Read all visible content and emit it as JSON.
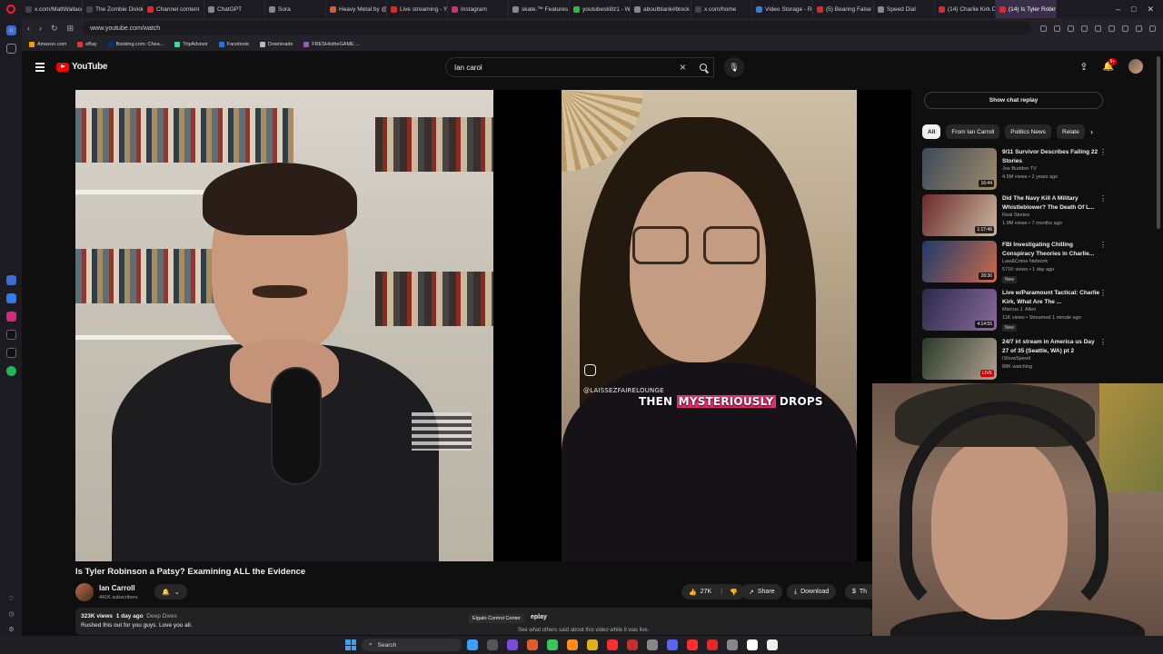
{
  "browser": {
    "tabs": [
      {
        "label": "x.com/MattWallace",
        "color": "#444444",
        "active": false
      },
      {
        "label": "The Zombie Divide",
        "color": "#444444",
        "active": false
      },
      {
        "label": "Channel content",
        "color": "#e02828",
        "active": false
      },
      {
        "label": "ChatGPT",
        "color": "#888888",
        "active": false
      },
      {
        "label": "Sora",
        "color": "#888888",
        "active": false
      },
      {
        "label": "Heavy Metal by @",
        "color": "#e05a2a",
        "active": false
      },
      {
        "label": "Live streaming - Yo",
        "color": "#e02828",
        "active": false
      },
      {
        "label": "Instagram",
        "color": "#d6297a",
        "active": false
      },
      {
        "label": "skate.™ Features",
        "color": "#888888",
        "active": false
      },
      {
        "label": "youtubeskillz1 - W",
        "color": "#2db84d",
        "active": false
      },
      {
        "label": "aboutblank#block",
        "color": "#888888",
        "active": false
      },
      {
        "label": "x.com/home",
        "color": "#444444",
        "active": false
      },
      {
        "label": "Video Storage - Re",
        "color": "#3a7bd5",
        "active": false
      },
      {
        "label": "(5) Bearing False W",
        "color": "#e02828",
        "active": false
      },
      {
        "label": "Speed Dial",
        "color": "#888888",
        "active": false
      },
      {
        "label": "(14) Charlie Kirk D",
        "color": "#e02828",
        "active": false
      },
      {
        "label": "(14) Is Tyler Robinson",
        "color": "#e02828",
        "active": true
      }
    ],
    "url": "www.youtube.com/watch",
    "bookmarks": [
      {
        "label": "Amazon.com",
        "color": "#ff9900"
      },
      {
        "label": "eBay",
        "color": "#e53238"
      },
      {
        "label": "Booking.com: Chea...",
        "color": "#003580"
      },
      {
        "label": "TripAdvisor",
        "color": "#34e0a1"
      },
      {
        "label": "Facebook",
        "color": "#1877f2"
      },
      {
        "label": "Downloads",
        "color": "#bbbbbb"
      },
      {
        "label": "FRESHistheGAME ...",
        "color": "#9b59b6"
      }
    ]
  },
  "youtube": {
    "logo_text": "YouTube",
    "search_value": "Ian carol",
    "notification_count": "9+"
  },
  "video": {
    "overlay_handle": "@LAISSEZFAIRELOUNGE",
    "caption_plain": "THEN",
    "caption_highlight": "MYSTERIOUSLY",
    "caption_end": "DROPS",
    "title": "Is Tyler Robinson a Patsy? Examining ALL the Evidence",
    "channel": "Ian Carroll",
    "subscribers": "441K subscribers",
    "likes": "27K",
    "share_label": "Share",
    "download_label": "Download",
    "thanks_label": "Th",
    "views": "323K views",
    "age": "1 day ago",
    "tag": "Deep Dives",
    "description": "Rushed this out for you guys. Love you all.",
    "tooltip": "Elgato Control Center",
    "replay_fragment": "eplay",
    "chat_hint": "See what others said about this video while it was live."
  },
  "sidebar_right": {
    "chat_replay_label": "Show chat replay",
    "chips": [
      {
        "label": "All",
        "selected": true
      },
      {
        "label": "From Ian Carroll",
        "selected": false
      },
      {
        "label": "Politics News",
        "selected": false
      },
      {
        "label": "Relate",
        "selected": false
      }
    ],
    "recommendations": [
      {
        "title": "9/11 Survivor Describes Falling 22 Stories",
        "channel": "Joe Budden TV",
        "meta": "4.5M views • 2 years ago",
        "duration": "16:44",
        "badge": "",
        "thumb_a": "#3b4a5a",
        "thumb_b": "#a08a6a"
      },
      {
        "title": "Did The Navy Kill A Military Whistleblower? The Death Of L...",
        "channel": "Real Stories",
        "meta": "1.9M views • 7 months ago",
        "duration": "1:17:46",
        "badge": "",
        "thumb_a": "#6b2a2a",
        "thumb_b": "#c9b8a0"
      },
      {
        "title": "FBI Investigating Chilling Conspiracy Theories in Charlie...",
        "channel": "Law&Crime Network",
        "meta": "571K views • 1 day ago",
        "duration": "28:36",
        "badge": "New",
        "thumb_a": "#1f3a6b",
        "thumb_b": "#c96a4a"
      },
      {
        "title": "Live w/Paramount Tactical: Charlie Kirk, What Are The ...",
        "channel": "Marcus J. Allen",
        "meta": "11K views • Streamed 1 minute ago",
        "duration": "4:14:55",
        "badge": "New",
        "thumb_a": "#2a2a4a",
        "thumb_b": "#8a6a9a"
      },
      {
        "title": "24/7 irl stream in America us Day 27 of 35 (Seattle, WA) pt 2",
        "channel": "IShowSpeed",
        "meta": "89K watching",
        "duration": "LIVE",
        "badge": "",
        "thumb_a": "#2a3a2a",
        "thumb_b": "#b0a090"
      }
    ]
  },
  "taskbar": {
    "search_label": "Search",
    "apps": [
      "#3aa0ff",
      "#555555",
      "#7a4bd6",
      "#e05a2a",
      "#3ac45a",
      "#ff8c1a",
      "#e0b020",
      "#ff2e2e",
      "#c03030",
      "#888888",
      "#5865f2",
      "#ff2e2e",
      "#e02828",
      "#888888",
      "#ffffff",
      "#eeeeee"
    ]
  }
}
